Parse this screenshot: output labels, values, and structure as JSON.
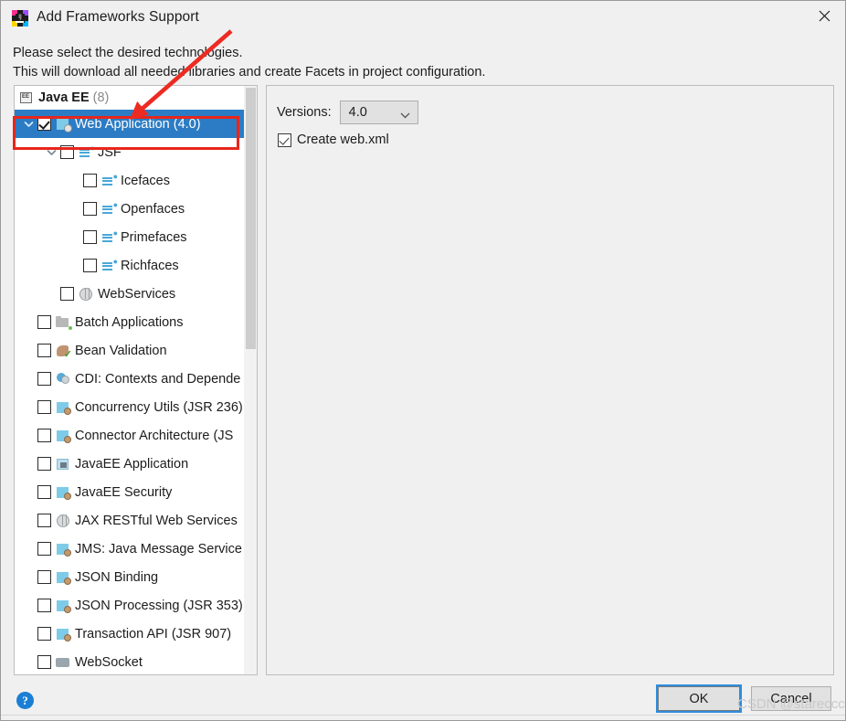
{
  "window": {
    "title": "Add Frameworks Support",
    "app_icon": "intellij-idea-icon",
    "close_icon": "close-icon"
  },
  "description": {
    "line1": "Please select the desired technologies.",
    "line2": "This will download all needed libraries and create Facets in project configuration."
  },
  "tree": {
    "header": {
      "label": "Java EE",
      "count": "(8)",
      "icon": "javaee-icon"
    },
    "items": [
      {
        "label": "Web Application (4.0)",
        "indent": 0,
        "checked": true,
        "selected": true,
        "chevron": "down",
        "icon": "web-application-icon"
      },
      {
        "label": "JSF",
        "indent": 1,
        "checked": false,
        "selected": false,
        "chevron": "down",
        "icon": "jsf-icon"
      },
      {
        "label": "Icefaces",
        "indent": 2,
        "checked": false,
        "selected": false,
        "chevron": "none",
        "icon": "jsf-icon"
      },
      {
        "label": "Openfaces",
        "indent": 2,
        "checked": false,
        "selected": false,
        "chevron": "none",
        "icon": "jsf-icon"
      },
      {
        "label": "Primefaces",
        "indent": 2,
        "checked": false,
        "selected": false,
        "chevron": "none",
        "icon": "jsf-icon"
      },
      {
        "label": "Richfaces",
        "indent": 2,
        "checked": false,
        "selected": false,
        "chevron": "none",
        "icon": "jsf-icon"
      },
      {
        "label": "WebServices",
        "indent": 1,
        "checked": false,
        "selected": false,
        "chevron": "none",
        "icon": "globe-icon"
      },
      {
        "label": "Batch Applications",
        "indent": 0,
        "checked": false,
        "selected": false,
        "chevron": "none",
        "icon": "batch-folder-icon"
      },
      {
        "label": "Bean Validation",
        "indent": 0,
        "checked": false,
        "selected": false,
        "chevron": "none",
        "icon": "bean-validation-icon"
      },
      {
        "label": "CDI: Contexts and Depende",
        "indent": 0,
        "checked": false,
        "selected": false,
        "chevron": "none",
        "icon": "cdi-icon"
      },
      {
        "label": "Concurrency Utils (JSR 236)",
        "indent": 0,
        "checked": false,
        "selected": false,
        "chevron": "none",
        "icon": "javaee-module-icon"
      },
      {
        "label": "Connector Architecture (JS",
        "indent": 0,
        "checked": false,
        "selected": false,
        "chevron": "none",
        "icon": "javaee-module-icon"
      },
      {
        "label": "JavaEE Application",
        "indent": 0,
        "checked": false,
        "selected": false,
        "chevron": "none",
        "icon": "javaee-application-icon"
      },
      {
        "label": "JavaEE Security",
        "indent": 0,
        "checked": false,
        "selected": false,
        "chevron": "none",
        "icon": "javaee-module-icon"
      },
      {
        "label": "JAX RESTful Web Services",
        "indent": 0,
        "checked": false,
        "selected": false,
        "chevron": "none",
        "icon": "globe-icon"
      },
      {
        "label": "JMS: Java Message Service",
        "indent": 0,
        "checked": false,
        "selected": false,
        "chevron": "none",
        "icon": "javaee-module-icon"
      },
      {
        "label": "JSON Binding",
        "indent": 0,
        "checked": false,
        "selected": false,
        "chevron": "none",
        "icon": "javaee-module-icon"
      },
      {
        "label": "JSON Processing (JSR 353)",
        "indent": 0,
        "checked": false,
        "selected": false,
        "chevron": "none",
        "icon": "javaee-module-icon"
      },
      {
        "label": "Transaction API (JSR 907)",
        "indent": 0,
        "checked": false,
        "selected": false,
        "chevron": "none",
        "icon": "javaee-module-icon"
      },
      {
        "label": "WebSocket",
        "indent": 0,
        "checked": false,
        "selected": false,
        "chevron": "none",
        "icon": "websocket-icon"
      }
    ]
  },
  "details": {
    "versions_label": "Versions:",
    "versions_value": "4.0",
    "versions_options": [
      "4.0"
    ],
    "create_webxml_label": "Create web.xml",
    "create_webxml_checked": true
  },
  "footer": {
    "help_icon": "help-icon",
    "help_glyph": "?",
    "ok_label": "OK",
    "cancel_label": "Cancel"
  },
  "annotations": {
    "highlight_color": "#e8261c",
    "watermark": "CSDN @stareccc"
  }
}
